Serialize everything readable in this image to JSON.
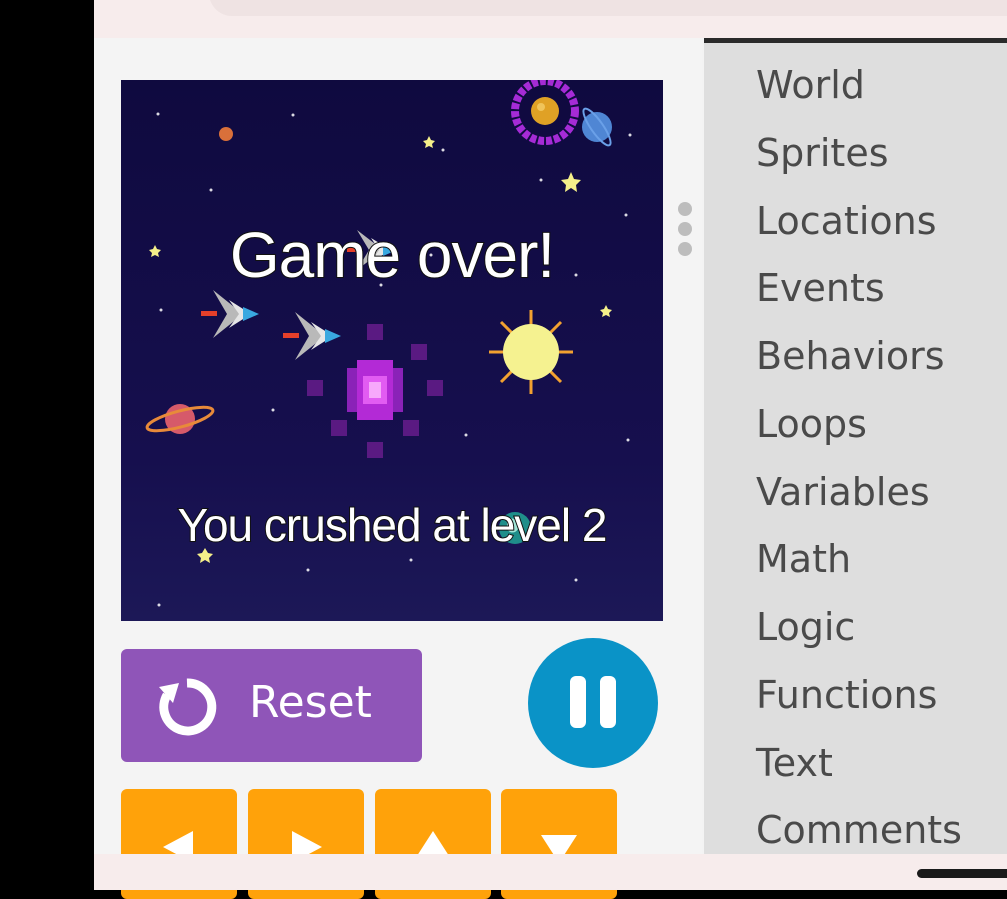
{
  "game": {
    "title": "Game over!",
    "message": "You crushed at level 2"
  },
  "controls": {
    "reset_label": "Reset",
    "reset_icon": "reset-icon",
    "pause_icon": "pause-icon",
    "arrows": [
      "left-arrow-icon",
      "right-arrow-icon",
      "up-arrow-icon",
      "down-arrow-icon"
    ]
  },
  "toolbox": {
    "categories": [
      "World",
      "Sprites",
      "Locations",
      "Events",
      "Behaviors",
      "Loops",
      "Variables",
      "Math",
      "Logic",
      "Functions",
      "Text",
      "Comments"
    ]
  },
  "colors": {
    "reset": "#8f55b8",
    "pause": "#0a93c7",
    "arrow": "#ffa20a",
    "toolbox_bg": "#dedede",
    "game_bg": "#120c45"
  }
}
